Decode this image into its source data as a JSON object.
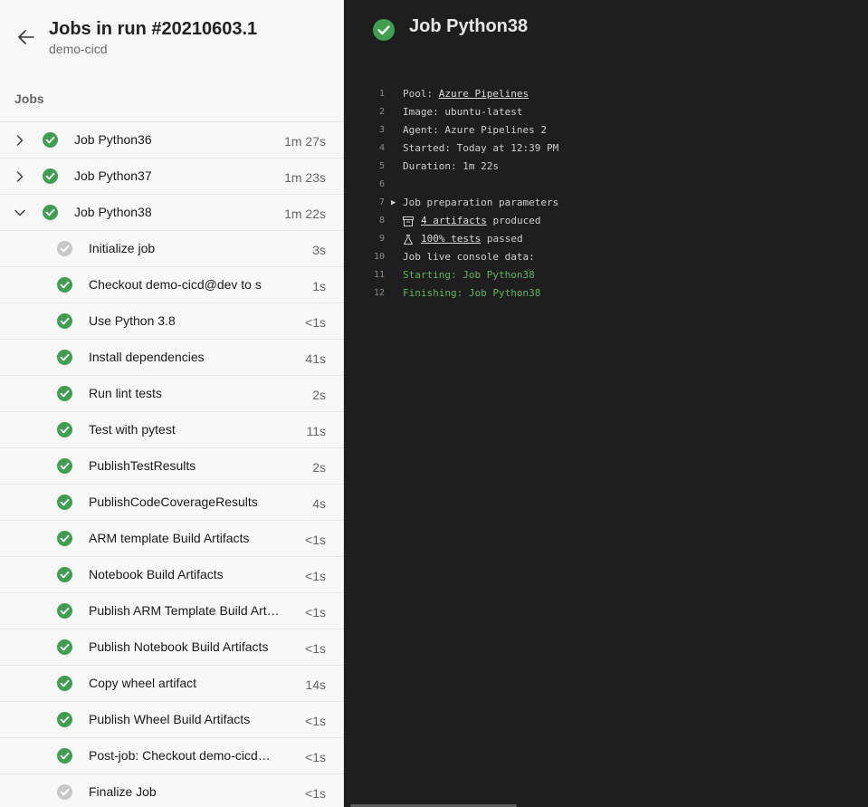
{
  "header": {
    "title": "Jobs in run #20210603.1",
    "subtitle": "demo-cicd"
  },
  "section_label": "Jobs",
  "jobs_list": [
    {
      "kind": "job",
      "expanded": false,
      "status": "success",
      "name": "Job Python36",
      "duration": "1m 27s"
    },
    {
      "kind": "job",
      "expanded": false,
      "status": "success",
      "name": "Job Python37",
      "duration": "1m 23s"
    },
    {
      "kind": "job",
      "expanded": true,
      "status": "success",
      "name": "Job Python38",
      "duration": "1m 22s"
    },
    {
      "kind": "step",
      "status": "skipped",
      "name": "Initialize job",
      "duration": "3s"
    },
    {
      "kind": "step",
      "status": "success",
      "name": "Checkout demo-cicd@dev to s",
      "duration": "1s"
    },
    {
      "kind": "step",
      "status": "success",
      "name": "Use Python 3.8",
      "duration": "<1s"
    },
    {
      "kind": "step",
      "status": "success",
      "name": "Install dependencies",
      "duration": "41s"
    },
    {
      "kind": "step",
      "status": "success",
      "name": "Run lint tests",
      "duration": "2s"
    },
    {
      "kind": "step",
      "status": "success",
      "name": "Test with pytest",
      "duration": "11s"
    },
    {
      "kind": "step",
      "status": "success",
      "name": "PublishTestResults",
      "duration": "2s"
    },
    {
      "kind": "step",
      "status": "success",
      "name": "PublishCodeCoverageResults",
      "duration": "4s"
    },
    {
      "kind": "step",
      "status": "success",
      "name": "ARM template Build Artifacts",
      "duration": "<1s"
    },
    {
      "kind": "step",
      "status": "success",
      "name": "Notebook Build Artifacts",
      "duration": "<1s"
    },
    {
      "kind": "step",
      "status": "success",
      "name": "Publish ARM Template Build Artifacts",
      "duration": "<1s"
    },
    {
      "kind": "step",
      "status": "success",
      "name": "Publish Notebook Build Artifacts",
      "duration": "<1s"
    },
    {
      "kind": "step",
      "status": "success",
      "name": "Copy wheel artifact",
      "duration": "14s"
    },
    {
      "kind": "step",
      "status": "success",
      "name": "Publish Wheel Build Artifacts",
      "duration": "<1s"
    },
    {
      "kind": "step",
      "status": "success",
      "name": "Post-job: Checkout demo-cicd@dev",
      "duration": "<1s"
    },
    {
      "kind": "step",
      "status": "skipped",
      "name": "Finalize Job",
      "duration": "<1s"
    }
  ],
  "detail": {
    "title": "Job Python38",
    "console": {
      "line_numbers": [
        "1",
        "2",
        "3",
        "4",
        "5",
        "6",
        "7",
        "8",
        "9",
        "10",
        "11",
        "12"
      ],
      "pool_label": "Pool: ",
      "pool_link": "Azure Pipelines",
      "image": "Image: ubuntu-latest",
      "agent": "Agent: Azure Pipelines 2",
      "started": "Started: Today at 12:39 PM",
      "duration": "Duration: 1m 22s",
      "prep_params": "Job preparation parameters",
      "artifacts_link": "4 artifacts",
      "artifacts_suffix": " produced",
      "tests_link": "100% tests",
      "tests_suffix": " passed",
      "live_console": "Job live console data:",
      "starting": "Starting: Job Python38",
      "finishing": "Finishing: Job Python38"
    }
  },
  "colors": {
    "success": "#3f9e4f",
    "skipped": "#c8c8c8",
    "console_green": "#5fb45f"
  },
  "icons": {
    "back": "arrow-left-icon",
    "collapsed": "chevron-right-icon",
    "expanded": "chevron-down-icon",
    "success": "check-circle-icon",
    "skipped": "check-circle-gray-icon",
    "artifacts": "artifact-box-icon",
    "tests": "flask-icon",
    "expand_params": "triangle-right-icon"
  }
}
